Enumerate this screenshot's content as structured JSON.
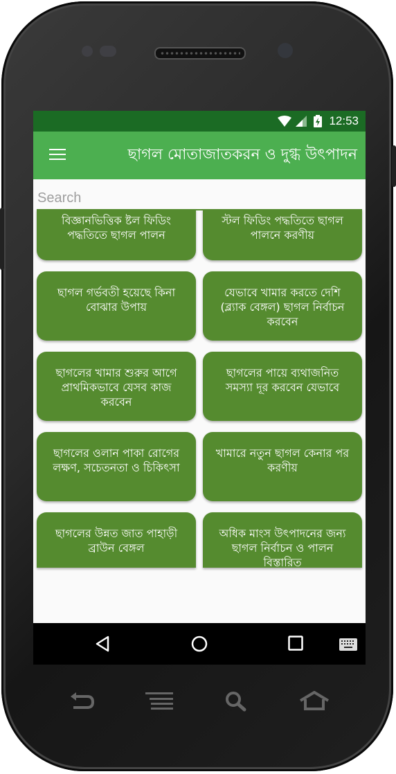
{
  "status_bar": {
    "time": "12:53",
    "icons": [
      "wifi-icon",
      "cell-signal-icon",
      "battery-charging-icon"
    ]
  },
  "app_bar": {
    "menu_icon": "hamburger-menu-icon",
    "title": "ছাগল মোতাজাতকরন ও দুগ্ধ উৎপাদন"
  },
  "search": {
    "placeholder": "Search",
    "value": ""
  },
  "articles": [
    {
      "title": "বিজ্ঞানভিত্তিক ষ্টল ফিডিং পদ্ধতিতে ছাগল পালন"
    },
    {
      "title": "স্টল ফিডিং পদ্ধতিতে ছাগল পালনে করণীয়"
    },
    {
      "title": "ছাগল গর্ভবতী হয়েছে কিনা বোঝার উপায়"
    },
    {
      "title": "যেভাবে খামার করতে দেশি (ব্ল্যাক বেঙ্গল) ছাগল নির্বাচন করবেন"
    },
    {
      "title": "ছাগলের খামার শুরুর আগে প্রাথমিকভাবে যেসব কাজ করবেন"
    },
    {
      "title": "ছাগলের পায়ে ব্যথাজনিত সমস্যা দূর করবেন যেভাবে"
    },
    {
      "title": "ছাগলের ওলান পাকা রোগের লক্ষণ, সচেতনতা ও চিকিৎসা"
    },
    {
      "title": "খামারে নতুন ছাগল কেনার পর করণীয়"
    },
    {
      "title": "ছাগলের উন্নত জাত পাহাড়ী ব্রাউন বেঙ্গল"
    },
    {
      "title": "অধিক মাংস উৎপাদনের জন্য ছাগল নির্বাচন ও পালন বিস্তারিত"
    }
  ],
  "nav_bar": {
    "buttons": [
      "back-icon",
      "home-icon",
      "recents-icon",
      "keyboard-icon"
    ]
  },
  "hardware_keys": [
    "back-key-icon",
    "menu-key-icon",
    "search-key-icon",
    "home-key-icon"
  ],
  "colors": {
    "status_bar": "#1b6b24",
    "app_bar": "#4caf50",
    "card": "#558b2f",
    "search_underline": "#558b2f"
  }
}
